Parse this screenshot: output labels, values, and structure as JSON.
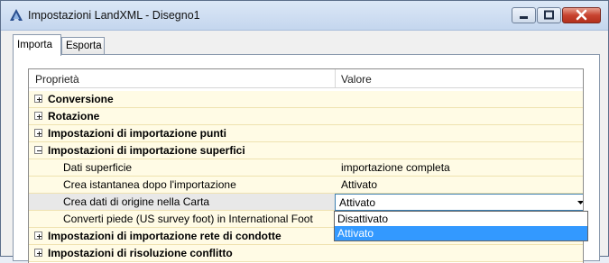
{
  "window": {
    "title": "Impostazioni LandXML - Disegno1",
    "accent": "#3399ff"
  },
  "tabs": [
    {
      "label": "Importa",
      "active": true
    },
    {
      "label": "Esporta",
      "active": false
    }
  ],
  "grid": {
    "columns": {
      "property": "Proprietà",
      "value": "Valore"
    },
    "rows": [
      {
        "kind": "category",
        "label": "Conversione",
        "expanded": false
      },
      {
        "kind": "category",
        "label": "Rotazione",
        "expanded": false
      },
      {
        "kind": "category",
        "label": "Impostazioni di importazione punti",
        "expanded": false
      },
      {
        "kind": "category",
        "label": "Impostazioni di importazione superfici",
        "expanded": true
      },
      {
        "kind": "property",
        "label": "Dati superficie",
        "value": "importazione completa"
      },
      {
        "kind": "property",
        "label": "Crea istantanea dopo l'importazione",
        "value": "Attivato"
      },
      {
        "kind": "property",
        "label": "Crea dati di origine nella Carta",
        "value": "Attivato",
        "selected": true
      },
      {
        "kind": "property",
        "label": "Converti piede (US survey foot) in International Foot",
        "value": ""
      },
      {
        "kind": "category",
        "label": "Impostazioni di importazione rete di condotte",
        "expanded": false
      },
      {
        "kind": "category",
        "label": "Impostazioni di risoluzione conflitto",
        "expanded": false
      }
    ]
  },
  "dropdown": {
    "options": [
      "Disattivato",
      "Attivato"
    ],
    "highlighted": "Attivato"
  }
}
